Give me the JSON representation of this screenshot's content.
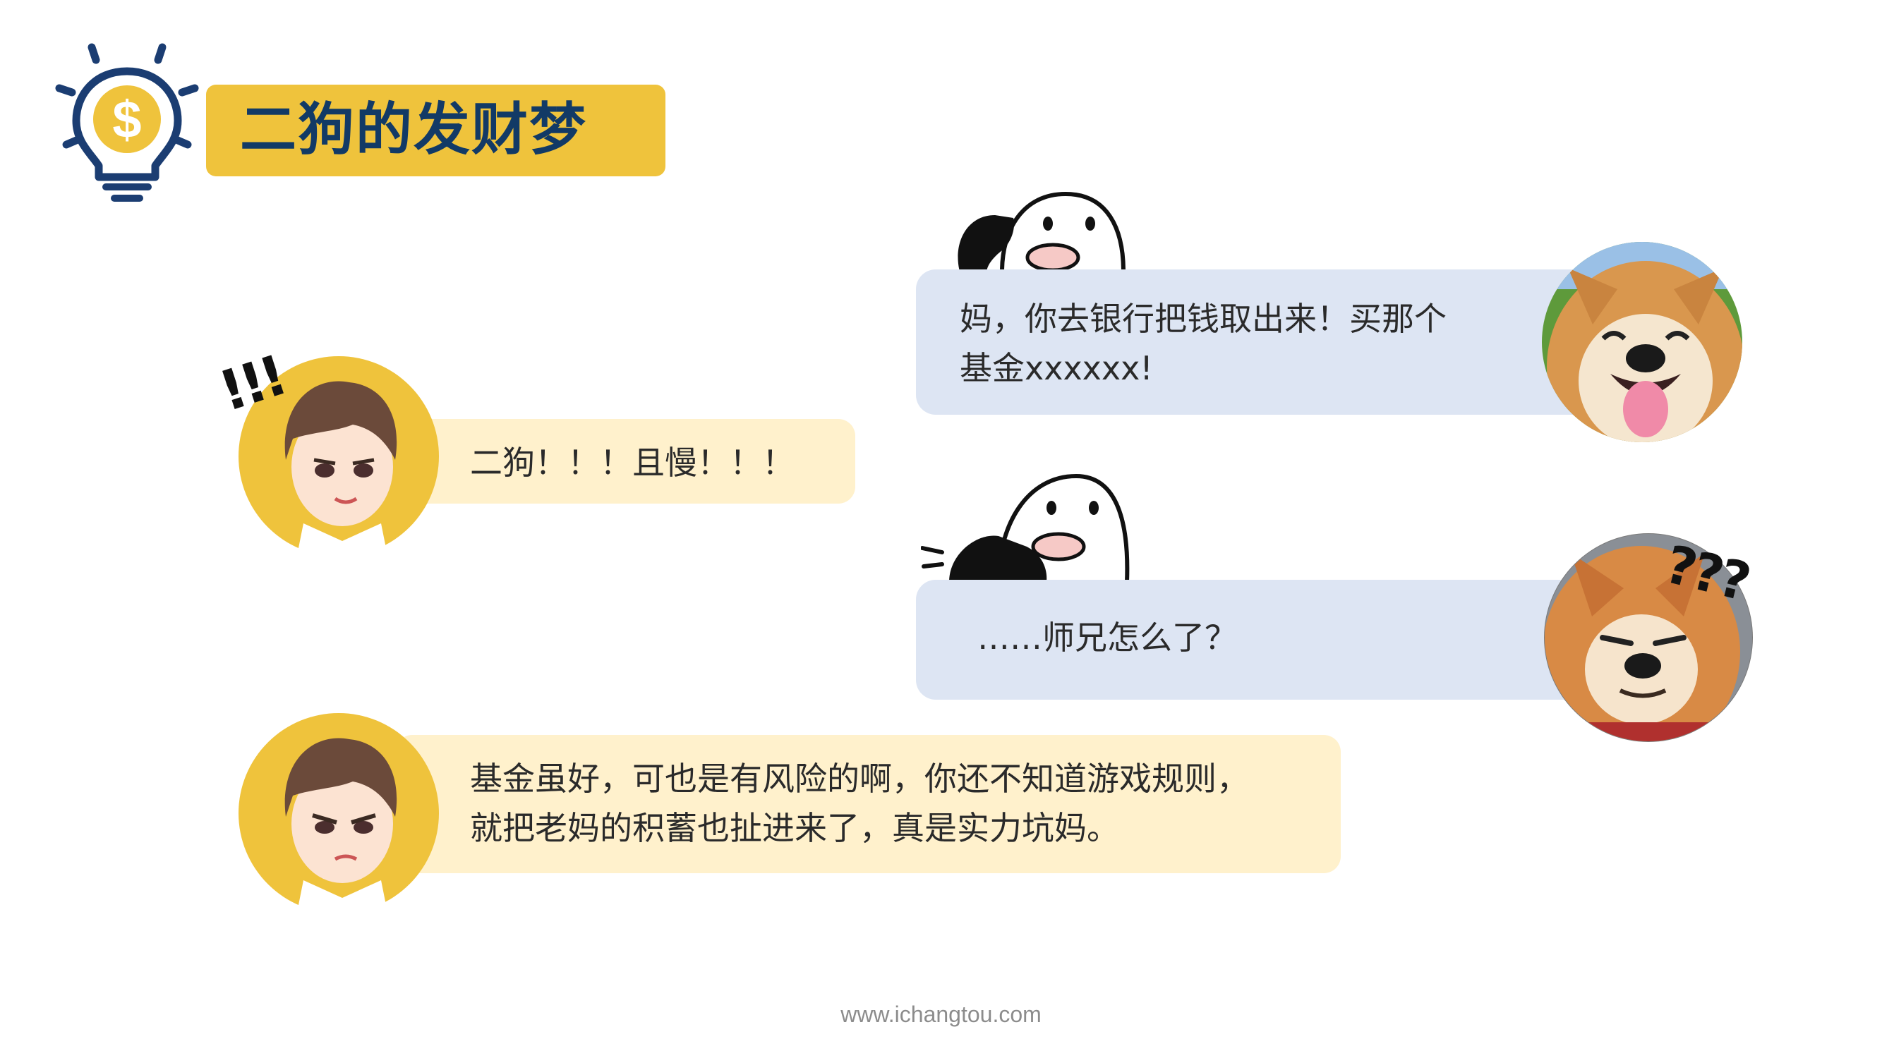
{
  "header": {
    "title": "二狗的发财梦",
    "icon": "lightbulb-dollar-icon"
  },
  "conversation": [
    {
      "speaker": "dog",
      "text_line1": "妈，你去银行把钱取出来！买那个",
      "text_line2": "基金xxxxxx!"
    },
    {
      "speaker": "boy",
      "text": "二狗！！！且慢！！！",
      "exclaim": "!!!"
    },
    {
      "speaker": "dog",
      "text": "……师兄怎么了？",
      "question": "???"
    },
    {
      "speaker": "boy",
      "text_line1": "基金虽好，可也是有风险的啊，你还不知道游戏规则，",
      "text_line2": "就把老妈的积蓄也扯进来了，真是实力坑妈。"
    }
  ],
  "footer": {
    "url": "www.ichangtou.com"
  },
  "colors": {
    "accent_yellow": "#EFC33C",
    "title_navy": "#123A66",
    "bubble_yellow": "#FFF1CC",
    "bubble_blue": "#DDE5F3"
  }
}
